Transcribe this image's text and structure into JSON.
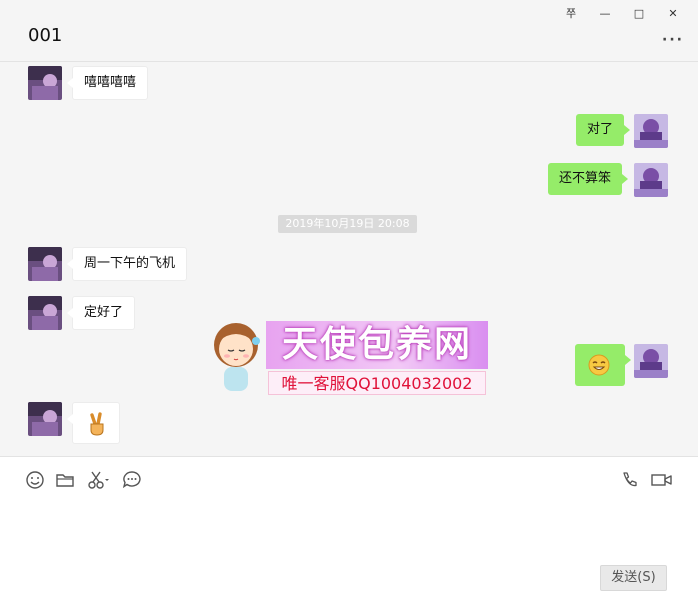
{
  "window": {
    "title": "001",
    "controls": {
      "pin": "쭈",
      "minimize": "—",
      "maximize": "□",
      "close": "✕"
    },
    "more": "···"
  },
  "messages": [
    {
      "side": "in",
      "text": "嘻嘻嘻嘻"
    },
    {
      "side": "out",
      "text": "对了"
    },
    {
      "side": "out",
      "text": "还不算笨"
    },
    {
      "side": "time",
      "text": "2019年10月19日 20:08"
    },
    {
      "side": "in",
      "text": "周一下午的飞机"
    },
    {
      "side": "in",
      "text": "定好了"
    },
    {
      "side": "out",
      "text": "",
      "emoji": "grin-emoji"
    },
    {
      "side": "in",
      "text": "",
      "emoji": "victory-hand-emoji"
    }
  ],
  "watermark": {
    "title": "天使包养网",
    "subtitle": "唯一客服QQ1004032002"
  },
  "toolbar": {
    "icons": [
      "smile-icon",
      "folder-icon",
      "scissors-icon",
      "chat-bubble-icon",
      "phone-icon",
      "video-icon"
    ]
  },
  "send": {
    "label": "发送(S)"
  },
  "colors": {
    "outgoing_bubble": "#95ec69",
    "incoming_bubble": "#ffffff",
    "background": "#f5f5f5"
  }
}
